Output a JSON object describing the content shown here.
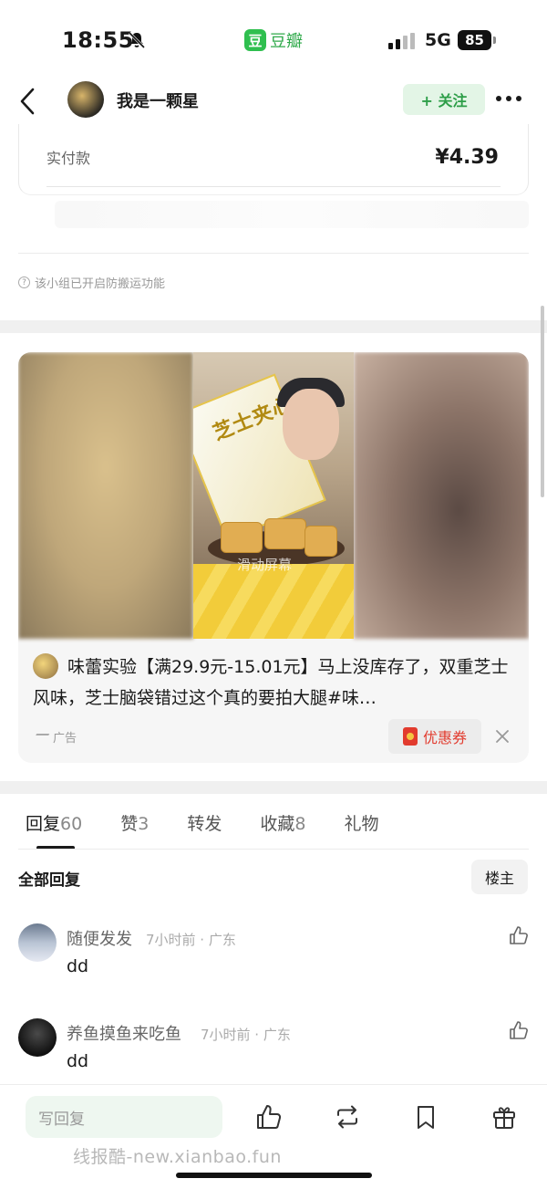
{
  "status_bar": {
    "time": "18:55",
    "app_logo": "豆",
    "app_name": "豆瓣",
    "network": "5G",
    "battery": "85"
  },
  "nav": {
    "title": "我是一颗星",
    "follow_label": "+ 关注"
  },
  "order": {
    "label": "实付款",
    "amount": "¥4.39"
  },
  "notice": {
    "icon_glyph": "?",
    "text": "该小组已开启防搬运功能"
  },
  "ad": {
    "box_text": "芝士夹心饼",
    "watermark": "滑动屏幕",
    "text": "味蕾实验【满29.9元-15.01元】马上没库存了，双重芝士风味，芝士脑袋错过这个真的要拍大腿#味…",
    "tag": "广告",
    "coupon_label": "优惠券"
  },
  "tabs": [
    {
      "label": "回复",
      "count": "60"
    },
    {
      "label": "赞",
      "count": "3"
    },
    {
      "label": "转发",
      "count": ""
    },
    {
      "label": "收藏",
      "count": "8"
    },
    {
      "label": "礼物",
      "count": ""
    }
  ],
  "filter": {
    "label": "全部回复",
    "op_label": "楼主"
  },
  "comments": [
    {
      "name": "随便发发",
      "meta": "7小时前 · 广东",
      "body": "dd"
    },
    {
      "name": "养鱼摸鱼来吃鱼",
      "meta": "7小时前 · 广东",
      "body": "dd"
    }
  ],
  "bottom_bar": {
    "reply_placeholder": "写回复",
    "icons": [
      "like-icon",
      "repost-icon",
      "bookmark-icon",
      "gift-icon"
    ]
  },
  "footer_watermark": "线报酷-new.xianbao.fun",
  "colors": {
    "brand_green": "#2fbf4f",
    "follow_bg": "#e3f5e6",
    "coupon_red": "#e23b2e"
  }
}
